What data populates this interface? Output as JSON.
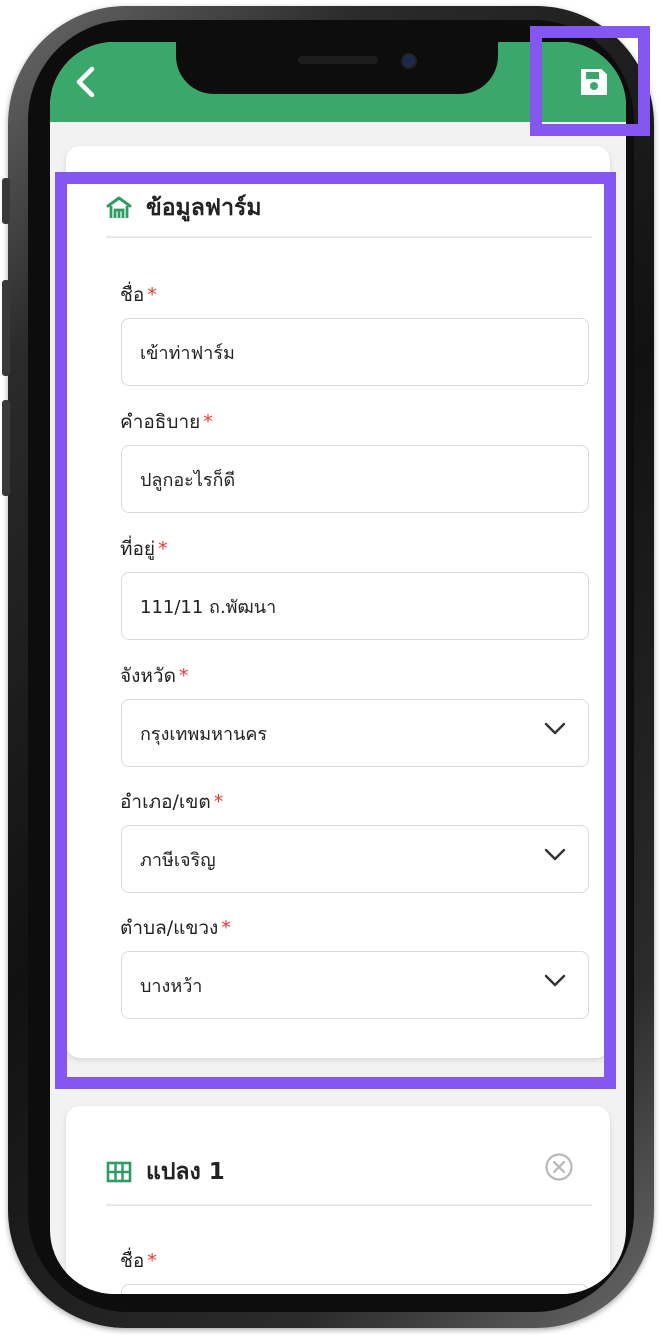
{
  "header": {
    "back_icon": "chevron-left-icon",
    "save_icon": "floppy-disk-icon",
    "color": "#3aa86b"
  },
  "farm_section": {
    "title": "ข้อมูลฟาร์ม",
    "icon": "farm-house-icon",
    "fields": [
      {
        "label": "ชื่อ",
        "required": "*",
        "value": "เข้าท่าฟาร์ม"
      },
      {
        "label": "คำอธิบาย",
        "required": "*",
        "value": "ปลูกอะไรก็ดี"
      },
      {
        "label": "ที่อยู่",
        "required": "*",
        "value": "111/11 ถ.พัฒนา"
      },
      {
        "label": "จังหวัด",
        "required": "*",
        "value": "กรุงเทพมหานคร",
        "dropdown": true
      },
      {
        "label": "อำเภอ/เขต",
        "required": "*",
        "value": "ภาษีเจริญ",
        "dropdown": true
      },
      {
        "label": "ตำบล/แขวง",
        "required": "*",
        "value": "บางหว้า",
        "dropdown": true
      }
    ]
  },
  "plot_section": {
    "title": "แปลง 1",
    "icon": "grid-icon",
    "remove_icon": "circle-x-icon",
    "fields": [
      {
        "label": "ชื่อ",
        "required": "*"
      }
    ]
  },
  "colors": {
    "accent_green": "#3aa86b",
    "highlight_purple": "#8458f0",
    "required_red": "#e53935"
  }
}
